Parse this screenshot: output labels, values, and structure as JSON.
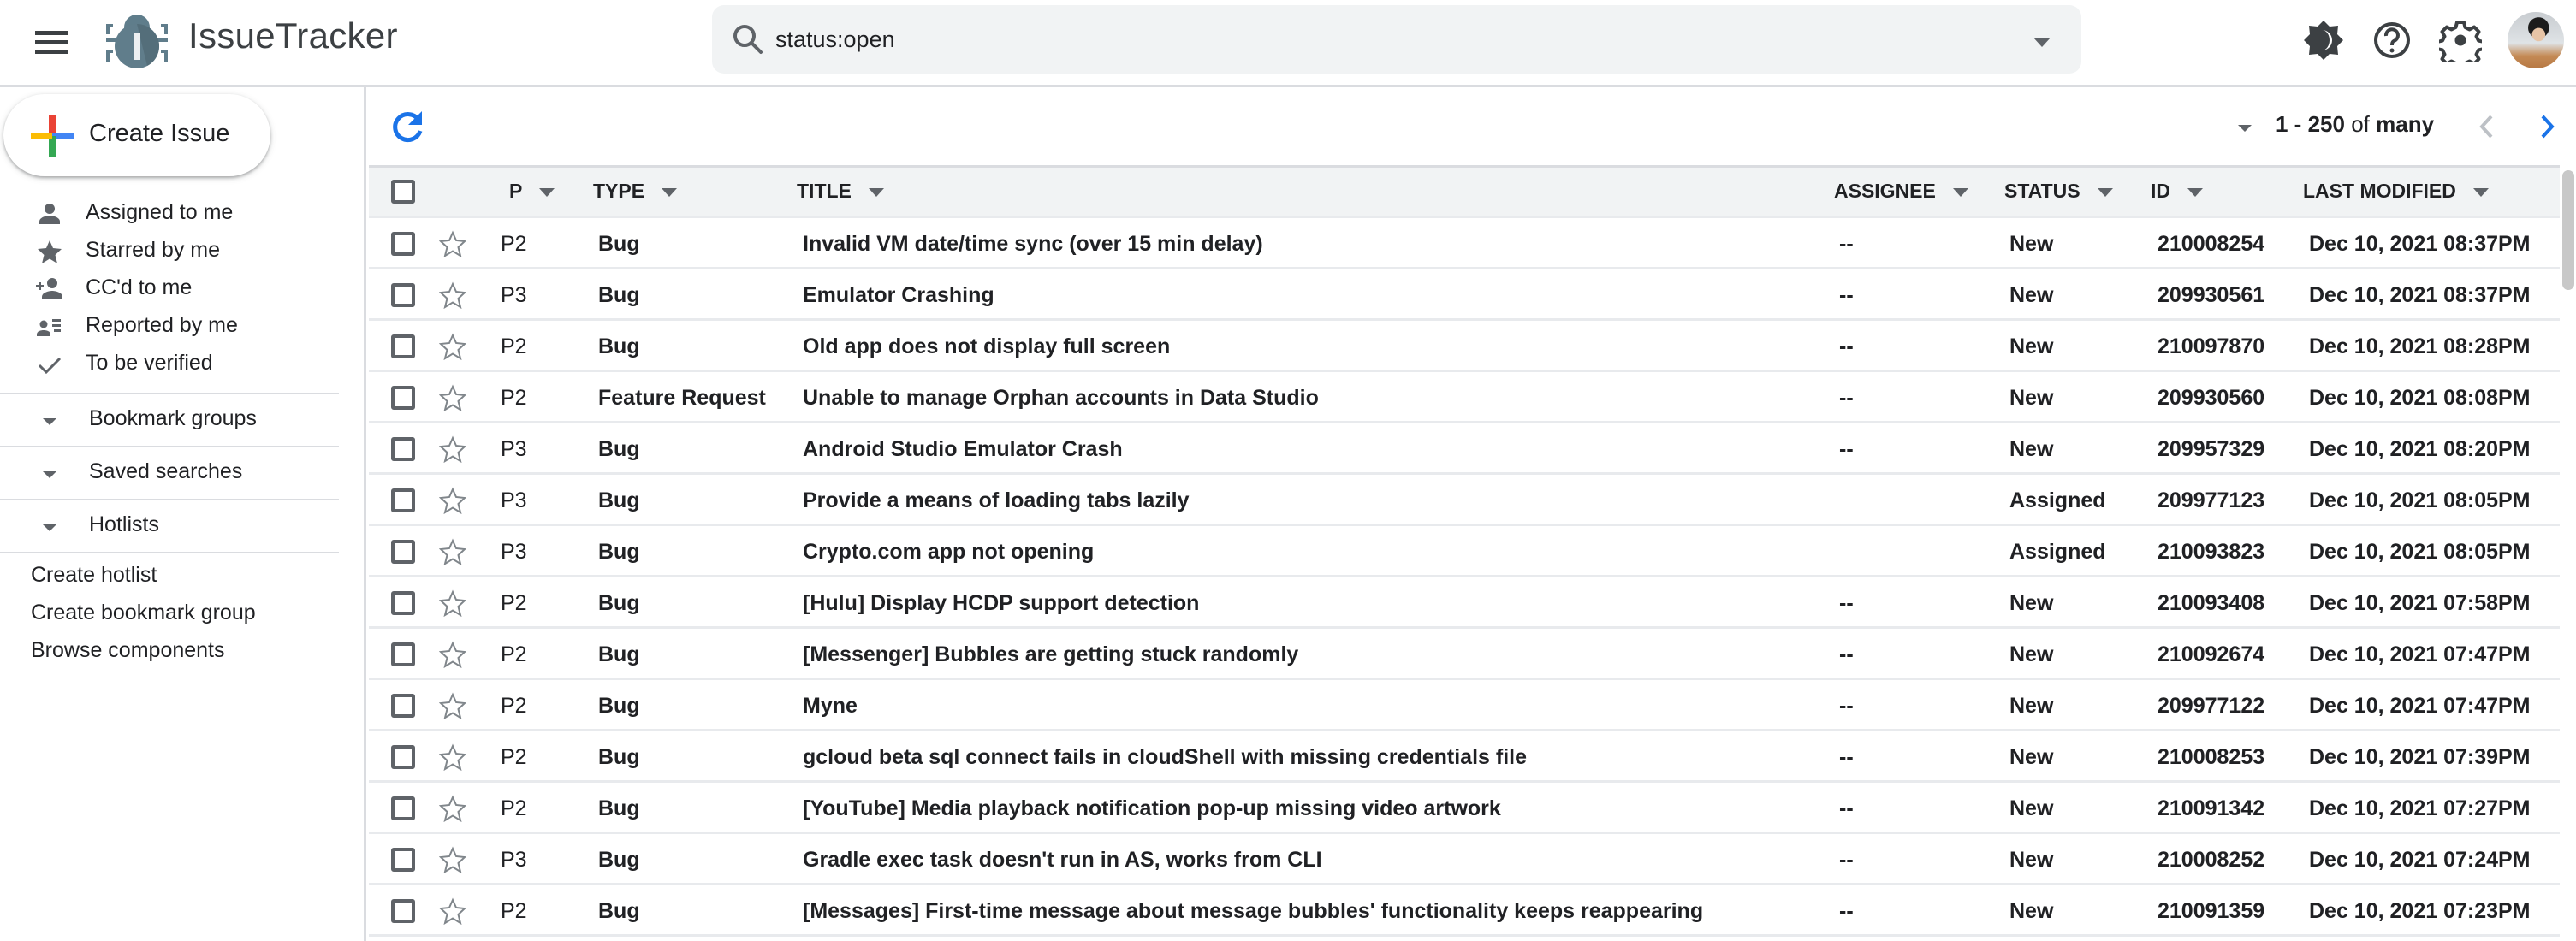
{
  "header": {
    "app_title": "IssueTracker",
    "menu_icon": "hamburger-menu-icon",
    "logo_icon": "bug-logo-icon",
    "search": {
      "value": "status:open",
      "icon": "search-icon"
    },
    "icons": [
      "theme-toggle-icon",
      "help-icon",
      "settings-icon"
    ],
    "avatar": "user-avatar"
  },
  "sidebar": {
    "create_label": "Create Issue",
    "nav_items": [
      {
        "label": "Assigned to me",
        "icon": "person-icon"
      },
      {
        "label": "Starred by me",
        "icon": "star-icon"
      },
      {
        "label": "CC'd to me",
        "icon": "person-add-icon"
      },
      {
        "label": "Reported by me",
        "icon": "person-list-icon"
      },
      {
        "label": "To be verified",
        "icon": "check-icon"
      }
    ],
    "sections": [
      {
        "label": "Bookmark groups"
      },
      {
        "label": "Saved searches"
      },
      {
        "label": "Hotlists"
      }
    ],
    "links": [
      {
        "label": "Create hotlist"
      },
      {
        "label": "Create bookmark group"
      },
      {
        "label": "Browse components"
      }
    ]
  },
  "toolbar": {
    "pager": {
      "range": "1 - 250",
      "of": "of",
      "total": "many"
    },
    "colors": {
      "accent": "#1a73e8",
      "disabled": "#bdc1c6"
    }
  },
  "table": {
    "columns": {
      "p": "P",
      "type": "TYPE",
      "title": "TITLE",
      "assignee": "ASSIGNEE",
      "status": "STATUS",
      "id": "ID",
      "modified": "LAST MODIFIED"
    },
    "rows": [
      {
        "p": "P2",
        "type": "Bug",
        "title": "Invalid VM date/time sync (over 15 min delay)",
        "assignee": "--",
        "status": "New",
        "id": "210008254",
        "modified": "Dec 10, 2021 08:37PM"
      },
      {
        "p": "P3",
        "type": "Bug",
        "title": "Emulator Crashing",
        "assignee": "--",
        "status": "New",
        "id": "209930561",
        "modified": "Dec 10, 2021 08:37PM"
      },
      {
        "p": "P2",
        "type": "Bug",
        "title": "Old app does not display full screen",
        "assignee": "--",
        "status": "New",
        "id": "210097870",
        "modified": "Dec 10, 2021 08:28PM"
      },
      {
        "p": "P2",
        "type": "Feature Request",
        "title": "Unable to manage Orphan accounts in Data Studio",
        "assignee": "--",
        "status": "New",
        "id": "209930560",
        "modified": "Dec 10, 2021 08:08PM"
      },
      {
        "p": "P3",
        "type": "Bug",
        "title": "Android Studio Emulator Crash",
        "assignee": "--",
        "status": "New",
        "id": "209957329",
        "modified": "Dec 10, 2021 08:20PM"
      },
      {
        "p": "P3",
        "type": "Bug",
        "title": "Provide a means of loading tabs lazily",
        "assignee": "",
        "status": "Assigned",
        "id": "209977123",
        "modified": "Dec 10, 2021 08:05PM"
      },
      {
        "p": "P3",
        "type": "Bug",
        "title": "Crypto.com app not opening",
        "assignee": "",
        "status": "Assigned",
        "id": "210093823",
        "modified": "Dec 10, 2021 08:05PM"
      },
      {
        "p": "P2",
        "type": "Bug",
        "title": "[Hulu] Display HCDP support detection",
        "assignee": "--",
        "status": "New",
        "id": "210093408",
        "modified": "Dec 10, 2021 07:58PM"
      },
      {
        "p": "P2",
        "type": "Bug",
        "title": "[Messenger] Bubbles are getting stuck randomly",
        "assignee": "--",
        "status": "New",
        "id": "210092674",
        "modified": "Dec 10, 2021 07:47PM"
      },
      {
        "p": "P2",
        "type": "Bug",
        "title": "Myne",
        "assignee": "--",
        "status": "New",
        "id": "209977122",
        "modified": "Dec 10, 2021 07:47PM"
      },
      {
        "p": "P2",
        "type": "Bug",
        "title": "gcloud beta sql connect fails in cloudShell with missing credentials file",
        "assignee": "--",
        "status": "New",
        "id": "210008253",
        "modified": "Dec 10, 2021 07:39PM"
      },
      {
        "p": "P2",
        "type": "Bug",
        "title": "[YouTube] Media playback notification pop-up missing video artwork",
        "assignee": "--",
        "status": "New",
        "id": "210091342",
        "modified": "Dec 10, 2021 07:27PM"
      },
      {
        "p": "P3",
        "type": "Bug",
        "title": "Gradle exec task doesn't run in AS, works from CLI",
        "assignee": "--",
        "status": "New",
        "id": "210008252",
        "modified": "Dec 10, 2021 07:24PM"
      },
      {
        "p": "P2",
        "type": "Bug",
        "title": "[Messages] First-time message about message bubbles' functionality keeps reappearing",
        "assignee": "--",
        "status": "New",
        "id": "210091359",
        "modified": "Dec 10, 2021 07:23PM"
      }
    ]
  }
}
